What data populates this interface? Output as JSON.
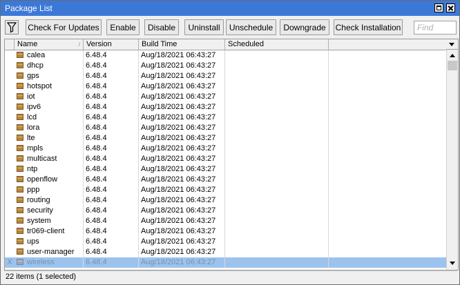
{
  "window": {
    "title": "Package List"
  },
  "toolbar": {
    "buttons": {
      "check_updates": "Check For Updates",
      "enable": "Enable",
      "disable": "Disable",
      "uninstall": "Uninstall",
      "unschedule": "Unschedule",
      "downgrade": "Downgrade",
      "check_installation": "Check Installation"
    },
    "find_placeholder": "Find"
  },
  "table": {
    "columns": [
      "Name",
      "Version",
      "Build Time",
      "Scheduled"
    ],
    "rows": [
      {
        "flag": "",
        "name": "calea",
        "version": "6.48.4",
        "build_time": "Aug/18/2021 06:43:27",
        "scheduled": ""
      },
      {
        "flag": "",
        "name": "dhcp",
        "version": "6.48.4",
        "build_time": "Aug/18/2021 06:43:27",
        "scheduled": ""
      },
      {
        "flag": "",
        "name": "gps",
        "version": "6.48.4",
        "build_time": "Aug/18/2021 06:43:27",
        "scheduled": ""
      },
      {
        "flag": "",
        "name": "hotspot",
        "version": "6.48.4",
        "build_time": "Aug/18/2021 06:43:27",
        "scheduled": ""
      },
      {
        "flag": "",
        "name": "iot",
        "version": "6.48.4",
        "build_time": "Aug/18/2021 06:43:27",
        "scheduled": ""
      },
      {
        "flag": "",
        "name": "ipv6",
        "version": "6.48.4",
        "build_time": "Aug/18/2021 06:43:27",
        "scheduled": ""
      },
      {
        "flag": "",
        "name": "lcd",
        "version": "6.48.4",
        "build_time": "Aug/18/2021 06:43:27",
        "scheduled": ""
      },
      {
        "flag": "",
        "name": "lora",
        "version": "6.48.4",
        "build_time": "Aug/18/2021 06:43:27",
        "scheduled": ""
      },
      {
        "flag": "",
        "name": "lte",
        "version": "6.48.4",
        "build_time": "Aug/18/2021 06:43:27",
        "scheduled": ""
      },
      {
        "flag": "",
        "name": "mpls",
        "version": "6.48.4",
        "build_time": "Aug/18/2021 06:43:27",
        "scheduled": ""
      },
      {
        "flag": "",
        "name": "multicast",
        "version": "6.48.4",
        "build_time": "Aug/18/2021 06:43:27",
        "scheduled": ""
      },
      {
        "flag": "",
        "name": "ntp",
        "version": "6.48.4",
        "build_time": "Aug/18/2021 06:43:27",
        "scheduled": ""
      },
      {
        "flag": "",
        "name": "openflow",
        "version": "6.48.4",
        "build_time": "Aug/18/2021 06:43:27",
        "scheduled": ""
      },
      {
        "flag": "",
        "name": "ppp",
        "version": "6.48.4",
        "build_time": "Aug/18/2021 06:43:27",
        "scheduled": ""
      },
      {
        "flag": "",
        "name": "routing",
        "version": "6.48.4",
        "build_time": "Aug/18/2021 06:43:27",
        "scheduled": ""
      },
      {
        "flag": "",
        "name": "security",
        "version": "6.48.4",
        "build_time": "Aug/18/2021 06:43:27",
        "scheduled": ""
      },
      {
        "flag": "",
        "name": "system",
        "version": "6.48.4",
        "build_time": "Aug/18/2021 06:43:27",
        "scheduled": ""
      },
      {
        "flag": "",
        "name": "tr069-client",
        "version": "6.48.4",
        "build_time": "Aug/18/2021 06:43:27",
        "scheduled": ""
      },
      {
        "flag": "",
        "name": "ups",
        "version": "6.48.4",
        "build_time": "Aug/18/2021 06:43:27",
        "scheduled": ""
      },
      {
        "flag": "",
        "name": "user-manager",
        "version": "6.48.4",
        "build_time": "Aug/18/2021 06:43:27",
        "scheduled": ""
      },
      {
        "flag": "X",
        "name": "wireless",
        "version": "6.48.4",
        "build_time": "Aug/18/2021 06:43:27",
        "scheduled": "",
        "selected": true
      }
    ]
  },
  "status": {
    "text": "22 items (1 selected)"
  },
  "colors": {
    "titlebar": "#3c78d8",
    "selection": "#9cc3ee",
    "package_icon": "#b8863a"
  }
}
